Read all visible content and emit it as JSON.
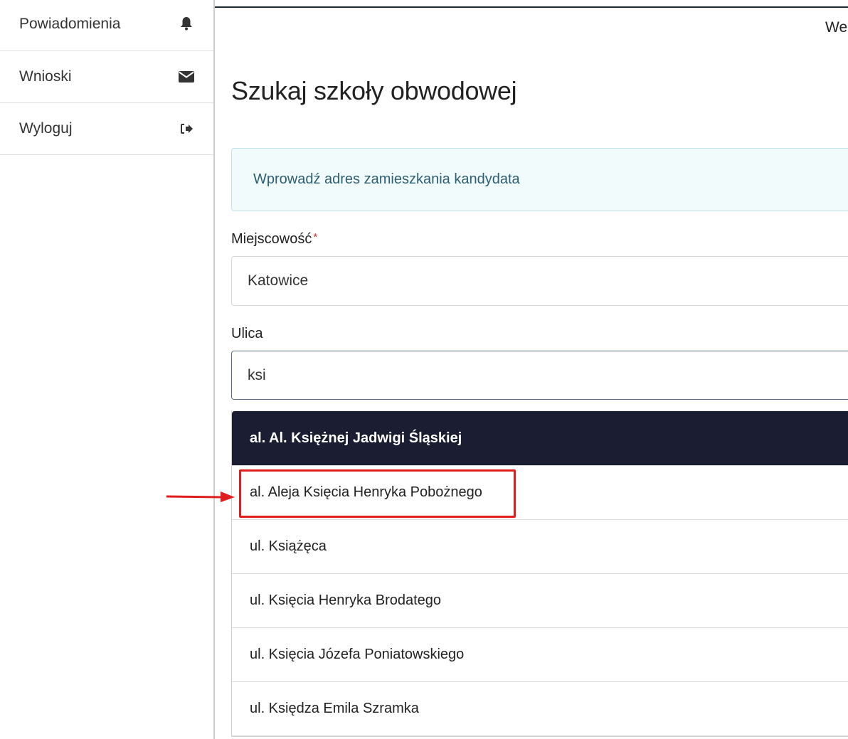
{
  "sidebar": {
    "items": [
      {
        "label": "Powiadomienia",
        "icon": "bell-icon"
      },
      {
        "label": "Wnioski",
        "icon": "envelope-icon"
      },
      {
        "label": "Wyloguj",
        "icon": "sign-out-icon"
      }
    ]
  },
  "header": {
    "top_right_text": "We"
  },
  "main": {
    "title": "Szukaj szkoły obwodowej",
    "info_message": "Wprowadź adres zamieszkania kandydata",
    "city": {
      "label": "Miejscowość",
      "required_mark": "*",
      "value": "Katowice"
    },
    "street": {
      "label": "Ulica",
      "value": "ksi"
    },
    "suggestions": [
      "al. Al. Księżnej Jadwigi Śląskiej",
      "al. Aleja Księcia Henryka Pobożnego",
      "ul. Książęca",
      "ul. Księcia Henryka Brodatego",
      "ul. Księcia Józefa Poniatowskiego",
      "ul. Księdza Emila Szramka"
    ]
  },
  "annotation": {
    "color": "#e01e1e"
  }
}
